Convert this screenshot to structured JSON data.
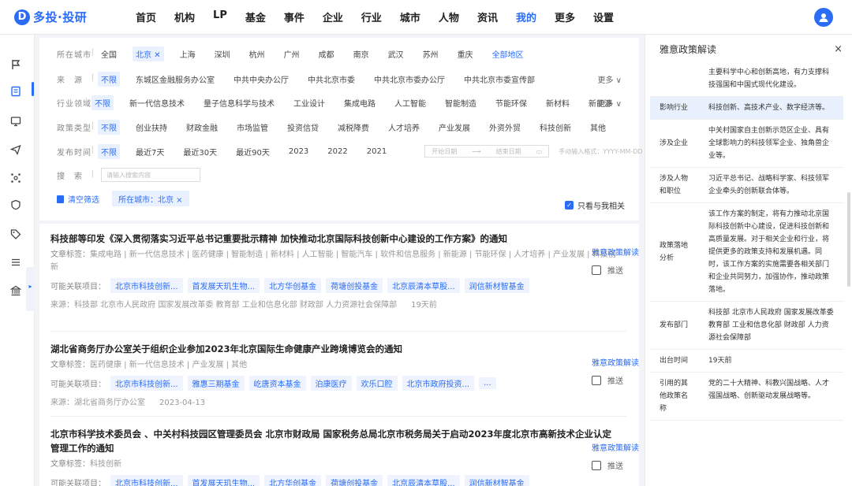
{
  "app": {
    "logo_mark": "D",
    "logo_text": "多投·投研"
  },
  "nav": {
    "items": [
      "首页",
      "机构",
      "LP",
      "基金",
      "事件",
      "企业",
      "行业",
      "城市",
      "人物",
      "资讯",
      "我的",
      "更多",
      "设置"
    ],
    "active_index": 10
  },
  "colors": {
    "accent": "#2b6cf6",
    "chip_bg": "#eaf1fe"
  },
  "icons": {
    "rail": [
      "flag-icon",
      "document-icon",
      "monitor-icon",
      "send-icon",
      "network-icon",
      "shield-icon",
      "tag-icon",
      "list-icon",
      "bank-icon"
    ]
  },
  "filters": {
    "city": {
      "label": "所在城市",
      "options": [
        "全国",
        "北京 ✕",
        "上海",
        "深圳",
        "杭州",
        "广州",
        "成都",
        "南京",
        "武汉",
        "苏州",
        "重庆",
        "全部地区"
      ]
    },
    "source": {
      "label": "来　源",
      "options": [
        "不限",
        "东城区金融服务办公室",
        "中共中央办公厅",
        "中共北京市委",
        "中共北京市委办公厅",
        "中共北京市委宣传部"
      ],
      "more": "更多 ∨"
    },
    "industry": {
      "label": "行业领域",
      "options": [
        "不限",
        "新一代信息技术",
        "量子信息科学与技术",
        "工业设计",
        "集成电路",
        "人工智能",
        "智能制造",
        "节能环保",
        "新材料",
        "新能源"
      ],
      "more": "更多 ∨"
    },
    "type": {
      "label": "政策类型",
      "options": [
        "不限",
        "创业扶持",
        "财政金融",
        "市场监管",
        "投资信贷",
        "减税降费",
        "人才培养",
        "产业发展",
        "外资外贸",
        "科技创新",
        "其他"
      ]
    },
    "time": {
      "label": "发布时间",
      "options": [
        "不限",
        "最近7天",
        "最近30天",
        "最近90天",
        "2023",
        "2022",
        "2021"
      ],
      "start_placeholder": "开始日期",
      "arrow": "⟶",
      "end_placeholder": "结束日期",
      "hint": "手动输入格式：YYYY-MM-DD"
    },
    "search": {
      "label": "搜　索",
      "placeholder": "请输入搜索内容"
    },
    "clear_label": "清空筛选",
    "active_chip": "所在城市：北京 ×",
    "only_mine": "只看与我相关"
  },
  "articles": [
    {
      "title": "科技部等印发《深入贯彻落实习近平总书记重要批示精神 加快推动北京国际科技创新中心建设的工作方案》的通知",
      "tags_label": "文章标签：",
      "tags": "集成电路 | 新一代信息技术 | 医药健康 | 智能制造 | 新材料 | 人工智能 | 智能汽车 | 软件和信息服务 | 新能源 | 节能环保 | 人才培养 | 产业发展 | 科技创新",
      "related_label": "可能关联项目：",
      "related": [
        "北京市科技创新...",
        "首发展天玑生物...",
        "北方华创基金",
        "荷塘创投基金",
        "北京辰清本草股...",
        "润信新材智基金"
      ],
      "source": "来源：科技部 北京市人民政府 国家发展改革委 教育部 工业和信息化部 财政部 人力资源社会保障部",
      "time": "19天前",
      "read": "雅意政策解读",
      "push": "推送"
    },
    {
      "title": "湖北省商务厅办公室关于组织企业参加2023年北京国际生命健康产业跨境博览会的通知",
      "tags_label": "文章标签：",
      "tags": "医药健康 | 新一代信息技术 | 产业发展 | 其他",
      "related_label": "可能关联项目：",
      "related": [
        "北京市科技创新...",
        "雅惠三期基金",
        "屹唐资本基金",
        "泊康医疗",
        "欢乐口腔",
        "北京市政府投资...",
        "..."
      ],
      "source": "来源：湖北省商务厅办公室",
      "time": "2023-04-13",
      "read": "雅意政策解读",
      "push": "推送"
    },
    {
      "title": "北京市科学技术委员会 、中关村科技园区管理委员会 北京市财政局 国家税务总局北京市税务局关于启动2023年度北京市高新技术企业认定管理工作的通知",
      "tags_label": "文章标签：",
      "tags": "科技创新",
      "related_label": "可能关联项目：",
      "related": [
        "北京市科技创新...",
        "首发展天玑生物...",
        "北方华创基金",
        "荷塘创投基金",
        "北京辰清本草股...",
        "润信新材智基金"
      ],
      "read": "雅意政策解读",
      "push": "推送"
    }
  ],
  "panel": {
    "title": "雅意政策解读",
    "close": "×",
    "rows": [
      {
        "key": "",
        "value": "主要科学中心和创新高地，有力支撑科技强国和中国式现代化建设。"
      },
      {
        "key": "影响行业",
        "value": "科技创新、高技术产业、数字经济等。"
      },
      {
        "key": "涉及企业",
        "value": "中关村国家自主创新示范区企业、具有全球影响力的科技领军企业、独角兽企业等。"
      },
      {
        "key": "涉及人物和职位",
        "value": "习近平总书记、战略科学家、科技领军企业牵头的创新联合体等。"
      },
      {
        "key": "政策落地分析",
        "value": "该工作方案的制定，将有力推动北京国际科技创新中心建设，促进科技创新和高质量发展。对于相关企业和行业，将提供更多的政策支持和发展机遇。同时，该工作方案的实施需要各相关部门和企业共同努力，加强协作，推动政策落地。"
      },
      {
        "key": "发布部门",
        "value": "科技部 北京市人民政府 国家发展改革委 教育部 工业和信息化部 财政部 人力资源社会保障部"
      },
      {
        "key": "出台时间",
        "value": "19天前"
      },
      {
        "key": "引用的其他政策名称",
        "value": "党的二十大精神、科教兴国战略、人才强国战略、创新驱动发展战略等。"
      }
    ]
  }
}
